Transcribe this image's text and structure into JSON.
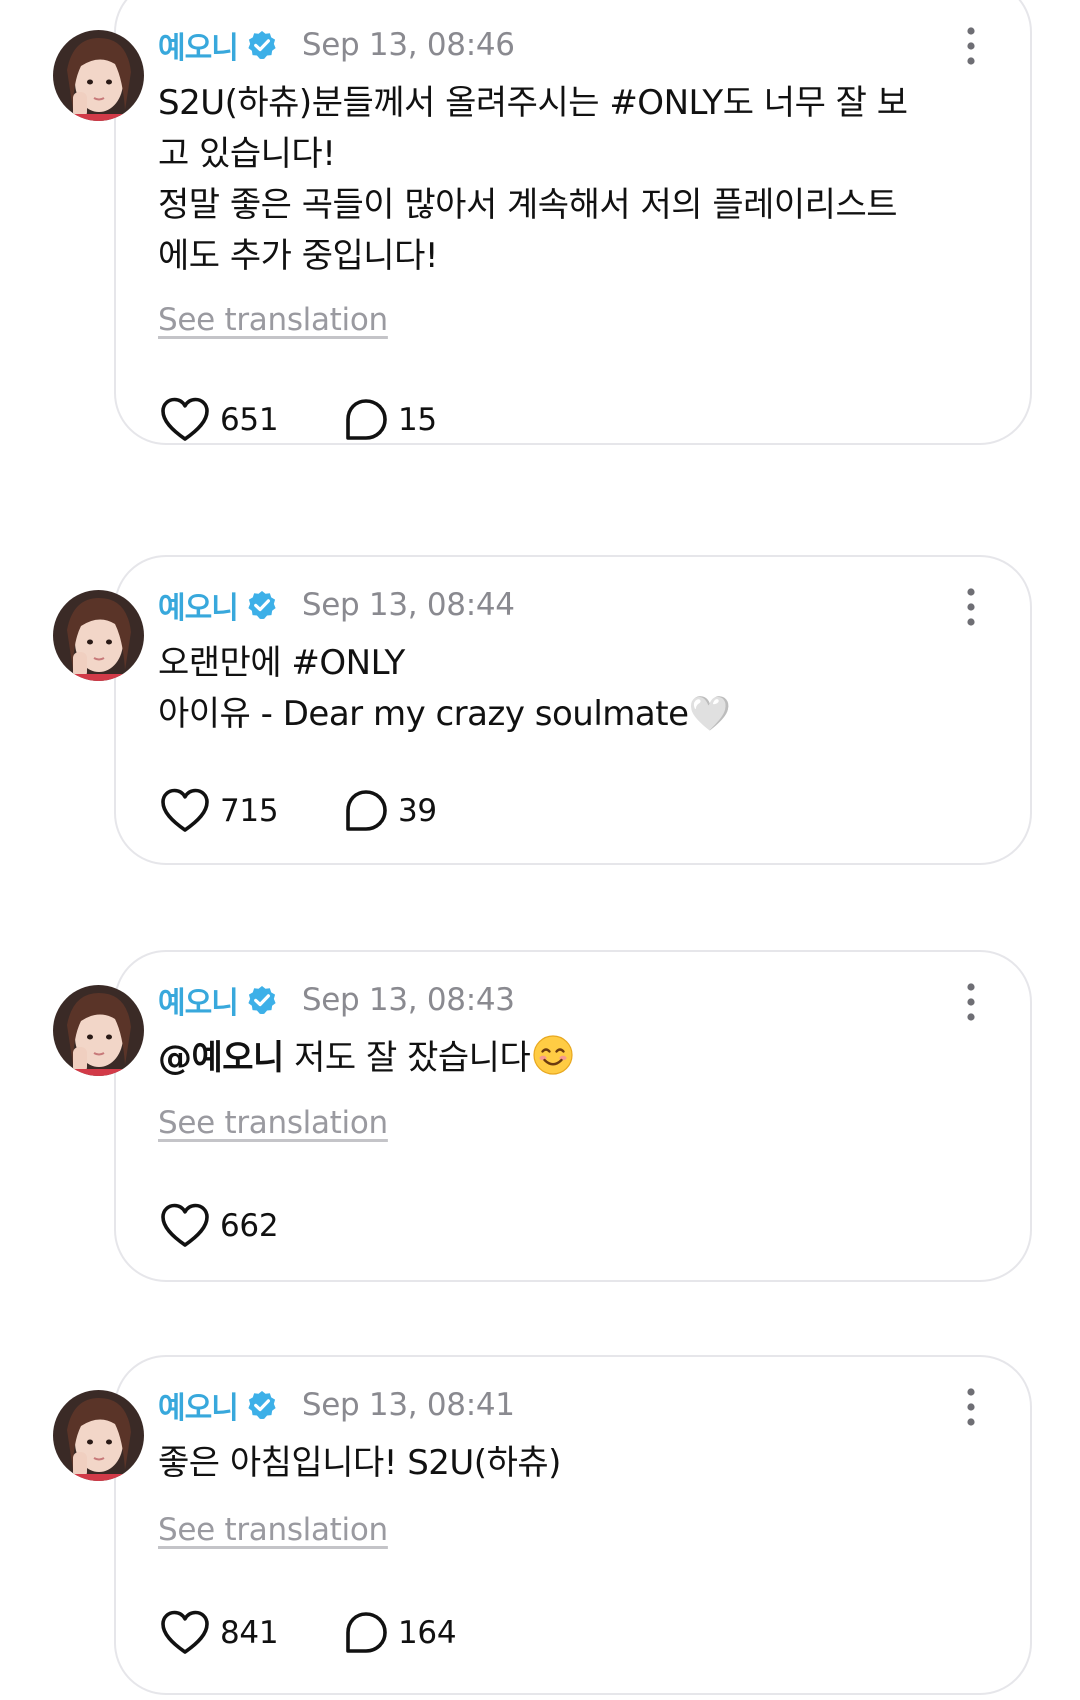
{
  "colors": {
    "author_name": "#38a8dc",
    "verified_badge": "#3db0e8",
    "timestamp": "#8a8a90",
    "card_border": "#e6e6ea",
    "link": "#9a9aa0"
  },
  "icons": {
    "verified": "verified-badge-icon",
    "more": "more-vertical-icon",
    "like": "heart-outline-icon",
    "reply": "speech-bubble-icon"
  },
  "posts": [
    {
      "author": "예오니",
      "timestamp": "Sep 13, 08:46",
      "body_lines": [
        "S2U(하츄)분들께서 올려주시는 #ONLY도 너무 잘 보",
        "고 있습니다!",
        "정말 좋은 곡들이 많아서 계속해서 저의 플레이리스트",
        "에도 추가 중입니다!"
      ],
      "see_translation": "See translation",
      "likes": "651",
      "replies": "15"
    },
    {
      "author": "예오니",
      "timestamp": "Sep 13, 08:44",
      "body_lines": [
        "오랜만에 #ONLY",
        "아이유 - Dear my crazy soulmate🤍"
      ],
      "likes": "715",
      "replies": "39"
    },
    {
      "author": "예오니",
      "timestamp": "Sep 13, 08:43",
      "mention": "@예오니",
      "body_text": " 저도 잘 잤습니다",
      "emoji": "smiling-face-icon",
      "see_translation": "See translation",
      "likes": "662"
    },
    {
      "author": "예오니",
      "timestamp": "Sep 13, 08:41",
      "body_lines": [
        "좋은 아침입니다! S2U(하츄)"
      ],
      "see_translation": "See translation",
      "likes": "841",
      "replies": "164"
    }
  ]
}
